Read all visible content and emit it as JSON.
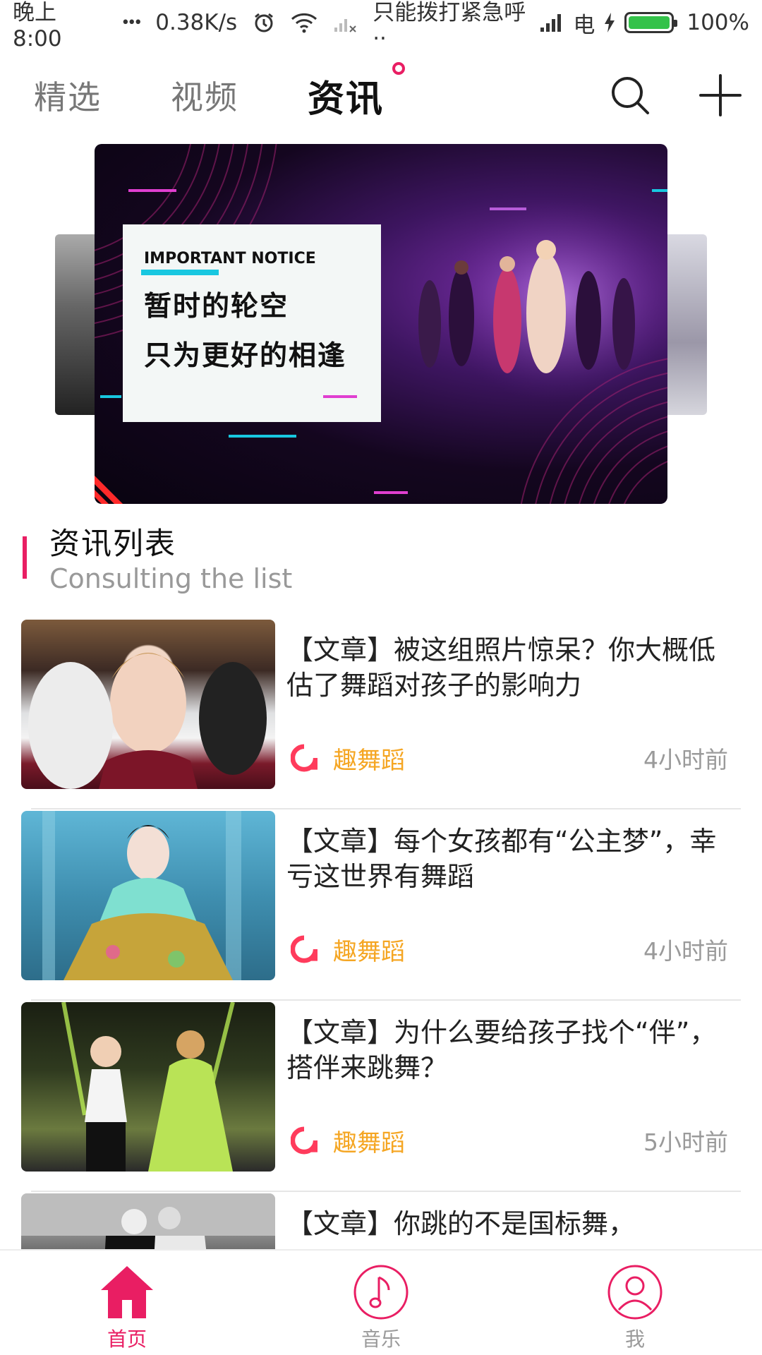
{
  "status_bar": {
    "time": "晚上8:00",
    "dots": "•••",
    "net_speed": "0.38K/s",
    "carrier_note": "只能拨打紧急呼··",
    "carrier": "电",
    "battery": "100%"
  },
  "top_nav": {
    "tabs": [
      {
        "label": "精选"
      },
      {
        "label": "视频"
      },
      {
        "label": "资讯"
      }
    ],
    "active_tab": 2,
    "accent": "#e91e63"
  },
  "banner": {
    "notice_en": "IMPORTANT NOTICE",
    "notice_line1": "暂时的轮空",
    "notice_line2": "只为更好的相逢"
  },
  "section": {
    "title": "资讯列表",
    "subtitle": "Consulting the list"
  },
  "news": [
    {
      "title": "【文章】被这组照片惊呆？你大概低估了舞蹈对孩子的影响力",
      "source": "趣舞蹈",
      "time": "4小时前"
    },
    {
      "title": "【文章】每个女孩都有“公主梦”，幸亏这世界有舞蹈",
      "source": "趣舞蹈",
      "time": "4小时前"
    },
    {
      "title": "【文章】为什么要给孩子找个“伴”，搭伴来跳舞？",
      "source": "趣舞蹈",
      "time": "5小时前"
    },
    {
      "title": "【文章】你跳的不是国标舞，",
      "source": "",
      "time": ""
    }
  ],
  "bottom_nav": {
    "items": [
      {
        "label": "首页",
        "icon": "home-icon"
      },
      {
        "label": "音乐",
        "icon": "music-note-icon"
      },
      {
        "label": "我",
        "icon": "user-icon"
      }
    ],
    "active": 0
  }
}
